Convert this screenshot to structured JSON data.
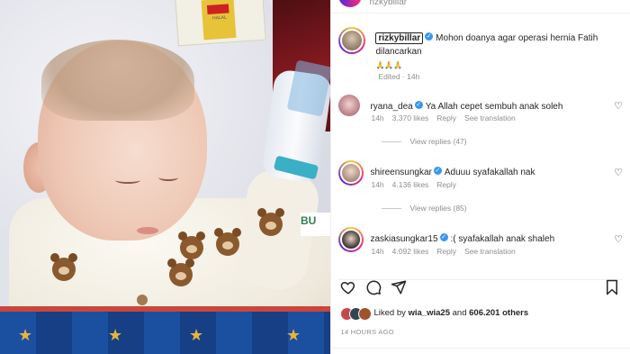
{
  "post_header": {
    "username_partial": "rizkybillar"
  },
  "caption": {
    "username": "rizkybillar",
    "text_line1": "Mohon doanya agar operasi hernia Fatih",
    "text_line2": "dilancarkan",
    "emoji": "🙏🙏🙏",
    "meta": "Edited · 14h"
  },
  "comments": [
    {
      "username": "ryana_dea",
      "verified": true,
      "text": "Ya Allah cepet sembuh anak soleh",
      "time": "14h",
      "likes": "3.370 likes",
      "reply": "Reply",
      "translate": "See translation",
      "view_replies": "View replies (47)"
    },
    {
      "username": "shireensungkar",
      "verified": true,
      "text": "Aduuu syafakallah nak",
      "time": "14h",
      "likes": "4.136 likes",
      "reply": "Reply",
      "translate": "",
      "view_replies": "View replies (85)"
    },
    {
      "username": "zaskiasungkar15",
      "verified": true,
      "text": ":( syafakallah anak shaleh",
      "time": "14h",
      "likes": "4.092 likes",
      "reply": "Reply",
      "translate": "See translation",
      "view_replies": ""
    }
  ],
  "actions": {
    "like": "heart-icon",
    "comment": "comment-icon",
    "share": "share-icon",
    "save": "bookmark-icon"
  },
  "likes_summary": {
    "prefix": "Liked by",
    "user": "wia_wia25",
    "joiner": "and",
    "count": "606.201 others"
  },
  "timestamp": "14 HOURS AGO",
  "photo": {
    "box_text": "HALAL",
    "sign_text": "BU"
  },
  "colors": {
    "verified": "#3897f0",
    "muted": "#8e8e8e",
    "text": "#262626"
  }
}
